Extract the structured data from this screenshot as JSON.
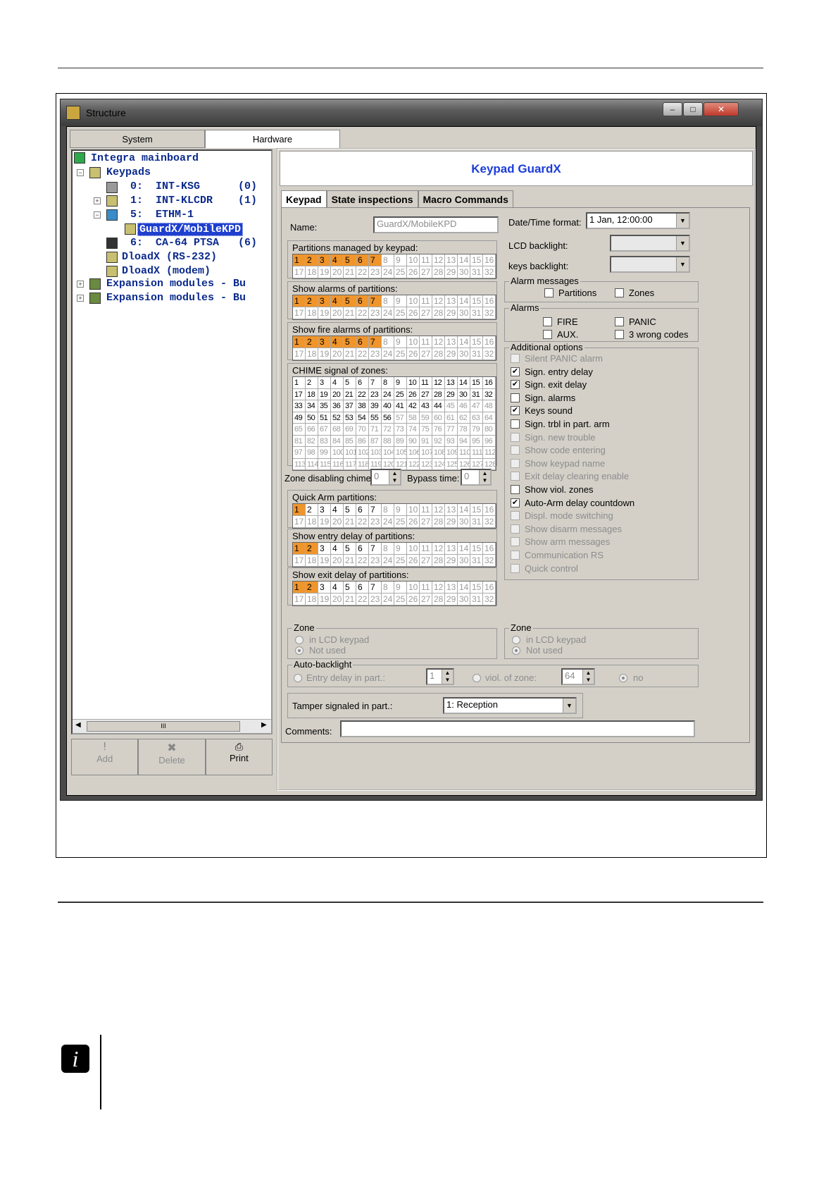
{
  "window": {
    "title": "Structure"
  },
  "top_tabs": [
    "System",
    "Hardware"
  ],
  "tree": [
    {
      "label": "Integra mainboard"
    },
    {
      "label": "Keypads"
    },
    {
      "label": "0:  INT-KSG      (0)"
    },
    {
      "label": "1:  INT-KLCDR    (1)"
    },
    {
      "label": "5:  ETHM-1"
    },
    {
      "label": "GuardX/MobileKPD"
    },
    {
      "label": "6:  CA-64 PTSA   (6)"
    },
    {
      "label": "DloadX (RS-232)"
    },
    {
      "label": "DloadX (modem)"
    },
    {
      "label": "Expansion modules - Bu"
    },
    {
      "label": "Expansion modules - Bu"
    }
  ],
  "scroll_thumb_label": "III",
  "toolbar": {
    "add": "Add",
    "delete": "Delete",
    "print": "Print"
  },
  "panel": {
    "header": "Keypad GuardX",
    "tabs": [
      "Keypad",
      "State inspections",
      "Macro Commands"
    ],
    "name_label": "Name:",
    "name_value": "GuardX/MobileKPD",
    "datetime_label": "Date/Time format:",
    "datetime_value": "1 Jan, 12:00:00",
    "lcd_backlight_label": "LCD backlight:",
    "keys_backlight_label": "keys backlight:",
    "alarm_messages": {
      "title": "Alarm messages",
      "partitions": "Partitions",
      "zones": "Zones"
    },
    "alarms": {
      "title": "Alarms",
      "fire": "FIRE",
      "panic": "PANIC",
      "aux": "AUX.",
      "wrong_codes": "3 wrong codes"
    },
    "additional_options_title": "Additional options",
    "additional_options": [
      {
        "label": "Silent PANIC alarm",
        "checked": false,
        "enabled": false
      },
      {
        "label": "Sign. entry delay",
        "checked": true,
        "enabled": true
      },
      {
        "label": "Sign. exit delay",
        "checked": true,
        "enabled": true
      },
      {
        "label": "Sign. alarms",
        "checked": false,
        "enabled": true
      },
      {
        "label": "Keys sound",
        "checked": true,
        "enabled": true
      },
      {
        "label": "Sign. trbl in part. arm",
        "checked": false,
        "enabled": true
      },
      {
        "label": "Sign. new trouble",
        "checked": false,
        "enabled": false
      },
      {
        "label": "Show code entering",
        "checked": false,
        "enabled": false
      },
      {
        "label": "Show keypad name",
        "checked": false,
        "enabled": false
      },
      {
        "label": "Exit delay clearing enable",
        "checked": false,
        "enabled": false
      },
      {
        "label": "Show viol. zones",
        "checked": false,
        "enabled": true
      },
      {
        "label": "Auto-Arm delay countdown",
        "checked": true,
        "enabled": true
      },
      {
        "label": "Displ. mode switching",
        "checked": false,
        "enabled": false
      },
      {
        "label": "Show disarm messages",
        "checked": false,
        "enabled": false
      },
      {
        "label": "Show arm messages",
        "checked": false,
        "enabled": false
      },
      {
        "label": "Communication RS",
        "checked": false,
        "enabled": false
      },
      {
        "label": "Quick control",
        "checked": false,
        "enabled": false
      }
    ],
    "partition_groups": [
      {
        "title": "Partitions managed by keypad:",
        "on": [
          1,
          2,
          3,
          4,
          5,
          6,
          7
        ]
      },
      {
        "title": "Show alarms of partitions:",
        "on": [
          1,
          2,
          3,
          4,
          5,
          6,
          7
        ]
      },
      {
        "title": "Show fire alarms of partitions:",
        "on": [
          1,
          2,
          3,
          4,
          5,
          6,
          7
        ]
      }
    ],
    "chime_title": "CHIME signal of zones:",
    "zone_disabling_chime_label": "Zone disabling chime:",
    "zone_disabling_chime_value": "0",
    "bypass_time_label": "Bypass time:",
    "bypass_time_value": "0",
    "partition_groups2": [
      {
        "title": "Quick Arm partitions:",
        "on": [
          1
        ]
      },
      {
        "title": "Show entry delay of partitions:",
        "on": [
          1,
          2
        ]
      },
      {
        "title": "Show exit delay of partitions:",
        "on": [
          1,
          2
        ]
      }
    ],
    "zone_left": {
      "title": "Zone",
      "opt1": "in LCD keypad",
      "opt2": "Not used"
    },
    "zone_right": {
      "title": "Zone",
      "opt1": "in LCD keypad",
      "opt2": "Not used"
    },
    "auto_backlight": {
      "title": "Auto-backlight",
      "entry_delay": "Entry delay in part.:",
      "entry_value": "1",
      "viol_zone": "viol. of zone:",
      "viol_value": "64",
      "no": "no"
    },
    "tamper_label": "Tamper signaled in part.:",
    "tamper_value": "1: Reception",
    "comments_label": "Comments:"
  }
}
